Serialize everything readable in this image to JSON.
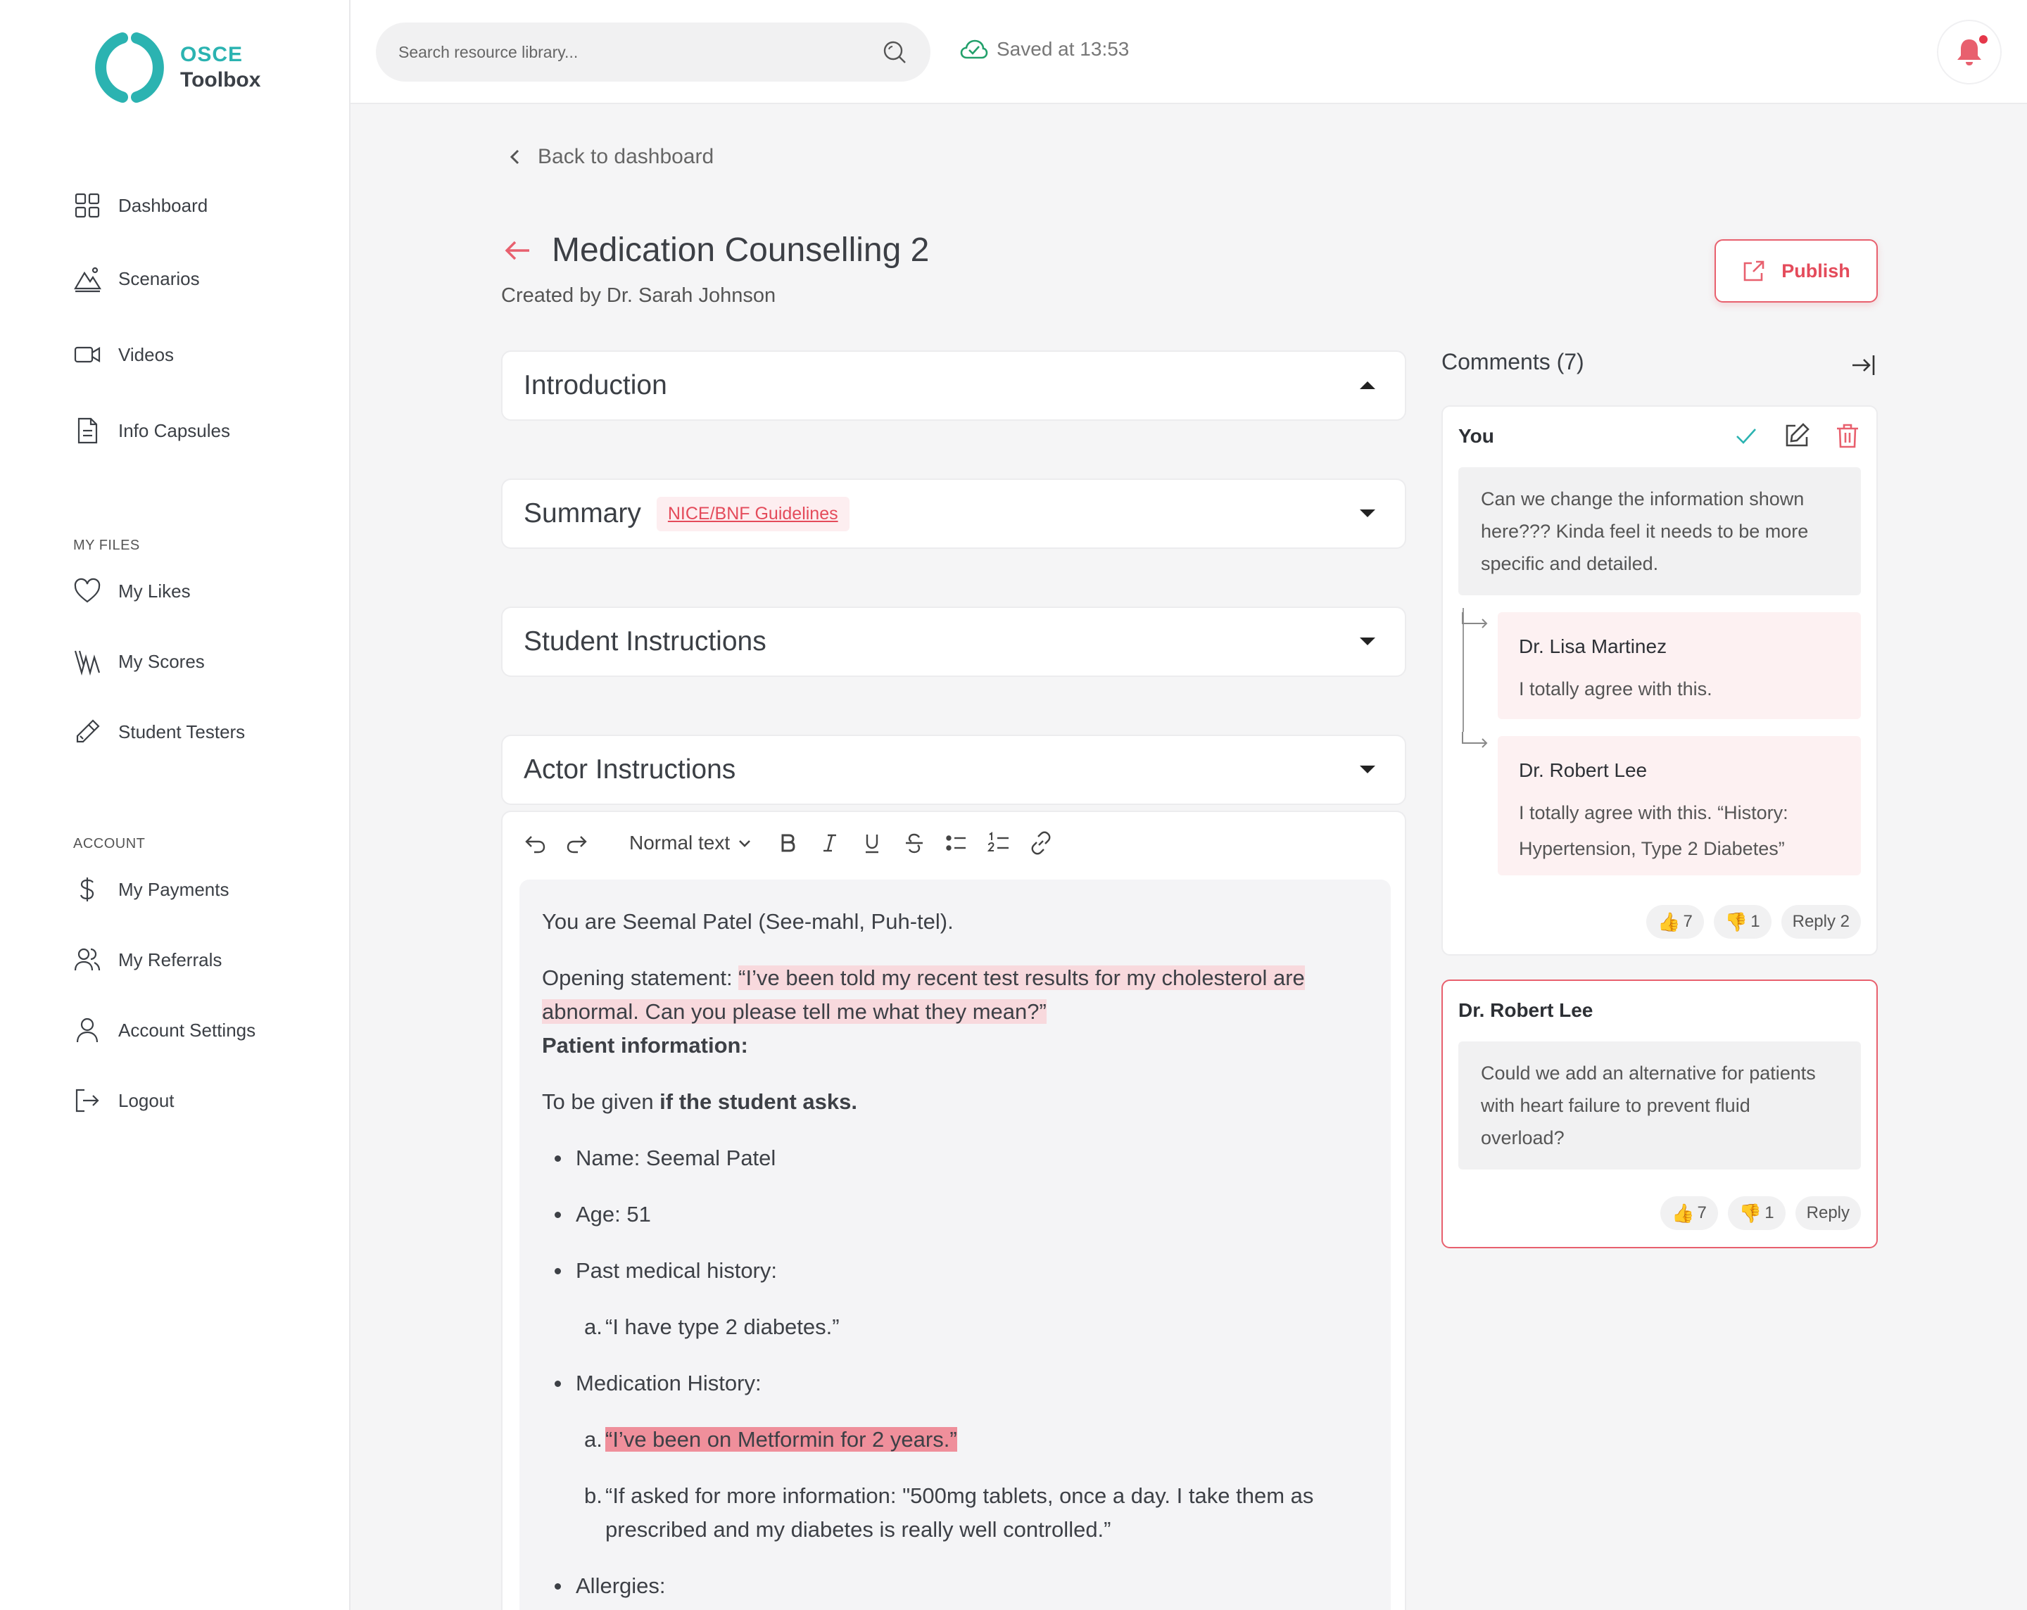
{
  "app": {
    "logo_line1": "OSCE",
    "logo_line2": "Toolbox"
  },
  "sidebar": {
    "items": [
      {
        "label": "Dashboard",
        "icon": "grid-icon"
      },
      {
        "label": "Scenarios",
        "icon": "mountain-icon"
      },
      {
        "label": "Videos",
        "icon": "video-icon"
      },
      {
        "label": "Info Capsules",
        "icon": "document-icon"
      }
    ],
    "my_files_heading": "MY FILES",
    "my_files": [
      {
        "label": "My Likes",
        "icon": "heart-icon"
      },
      {
        "label": "My Scores",
        "icon": "scores-icon"
      },
      {
        "label": "Student Testers",
        "icon": "pipette-icon"
      }
    ],
    "account_heading": "ACCOUNT",
    "account": [
      {
        "label": "My Payments",
        "icon": "dollar-icon"
      },
      {
        "label": "My Referrals",
        "icon": "users-icon"
      },
      {
        "label": "Account Settings",
        "icon": "user-icon"
      },
      {
        "label": "Logout",
        "icon": "logout-icon"
      }
    ]
  },
  "topbar": {
    "search_placeholder": "Search resource library...",
    "saved_status": "Saved at 13:53"
  },
  "page": {
    "back_label": "Back to dashboard",
    "title": "Medication Counselling 2",
    "created_by": "Created by Dr. Sarah Johnson",
    "publish_label": "Publish"
  },
  "sections": [
    {
      "title": "Introduction",
      "expanded": true
    },
    {
      "title": "Summary",
      "tag": "NICE/BNF Guidelines",
      "expanded": false
    },
    {
      "title": "Student Instructions",
      "expanded": false
    },
    {
      "title": "Actor Instructions",
      "expanded": false
    }
  ],
  "editor": {
    "text_style": "Normal text",
    "intro_line": "You are Seemal Patel (See-mahl, Puh-tel).",
    "opening_label": "Opening statement: ",
    "opening_quote": "“I’ve been told my recent test results for my cholesterol are abnormal. Can you please tell me what they mean?”",
    "patient_info_heading": "Patient information:",
    "given_prefix": "To be given ",
    "given_bold": "if the student asks.",
    "name": "Name: Seemal  Patel",
    "age": "Age: 51",
    "pmh": "Past medical history:",
    "pmh_a": "“I have type 2 diabetes.”",
    "med_history": "Medication History:",
    "med_a": "“I’ve been on Metformin for 2 years.”",
    "med_b": "“If asked for more information: \"500mg tablets, once a day. I take them as prescribed and my diabetes is really well controlled.”",
    "allergies": "Allergies:",
    "letter_a": "a.",
    "letter_b": "b."
  },
  "comments": {
    "heading": "Comments (7)",
    "thread1": {
      "author": "You",
      "text": "Can we change the information shown here??? Kinda feel it needs to be more specific and detailed.",
      "replies": [
        {
          "name": "Dr. Lisa Martinez",
          "text": "I totally agree with this."
        },
        {
          "name": "Dr. Robert Lee",
          "text": "I totally agree with this. “History: Hypertension, Type 2 Diabetes”"
        }
      ],
      "likes": "7",
      "dislikes": "1",
      "reply_label": "Reply 2"
    },
    "thread2": {
      "author": "Dr. Robert Lee",
      "text": "Could we add an alternative for patients with heart failure to prevent fluid overload?",
      "likes": "7",
      "dislikes": "1",
      "reply_label": "Reply"
    }
  },
  "colors": {
    "accent": "#e8606e",
    "brand": "#2bb3b1",
    "success": "#22a06b"
  }
}
